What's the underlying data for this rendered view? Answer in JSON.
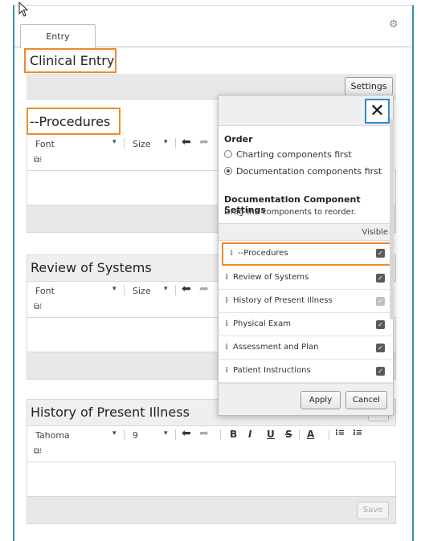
{
  "tabs": [
    {
      "label": "Entry"
    }
  ],
  "icons": {
    "cursor": "arrow-cursor-icon",
    "gear": "gear-icon",
    "close": "close-icon",
    "grip": "drag-handle-icon",
    "checkbox": "checkbox-checked-icon",
    "insert": "insert-field-icon",
    "undo": "undo-icon",
    "redo": "redo-icon"
  },
  "page": {
    "title": "Clinical Entry"
  },
  "toolbar": {
    "settings_label": "Settings"
  },
  "sections": [
    {
      "title": "--Procedures",
      "font_label": "Font",
      "size_label": "Size"
    },
    {
      "title": "Review of Systems",
      "font_label": "Font",
      "size_label": "Size"
    },
    {
      "title": "History of Present Illness",
      "font_label": "Tahoma",
      "size_label": "9",
      "save_label": "Save",
      "format_buttons": [
        "B",
        "I",
        "U",
        "S",
        "A",
        "⁝≡",
        "⁝≡"
      ]
    }
  ],
  "settings_panel": {
    "close_label": "✕",
    "order_title": "Order",
    "order_options": [
      {
        "label": "Charting components first",
        "selected": false
      },
      {
        "label": "Documentation components first",
        "selected": true
      }
    ],
    "components_title": "Documentation Component Settings",
    "components_subtitle": "Drag the components to reorder.",
    "visible_header": "Visible",
    "components": [
      {
        "label": "--Procedures",
        "visible": true
      },
      {
        "label": "Review of Systems",
        "visible": true
      },
      {
        "label": "History of Present Illness",
        "visible": true
      },
      {
        "label": "Physical Exam",
        "visible": true
      },
      {
        "label": "Assessment and Plan",
        "visible": true
      },
      {
        "label": "Patient Instructions",
        "visible": true
      }
    ],
    "apply_label": "Apply",
    "cancel_label": "Cancel"
  },
  "colors": {
    "highlight": "#ee8a2a",
    "frame": "#3a8fb3",
    "close_border": "#2a8ccf"
  }
}
